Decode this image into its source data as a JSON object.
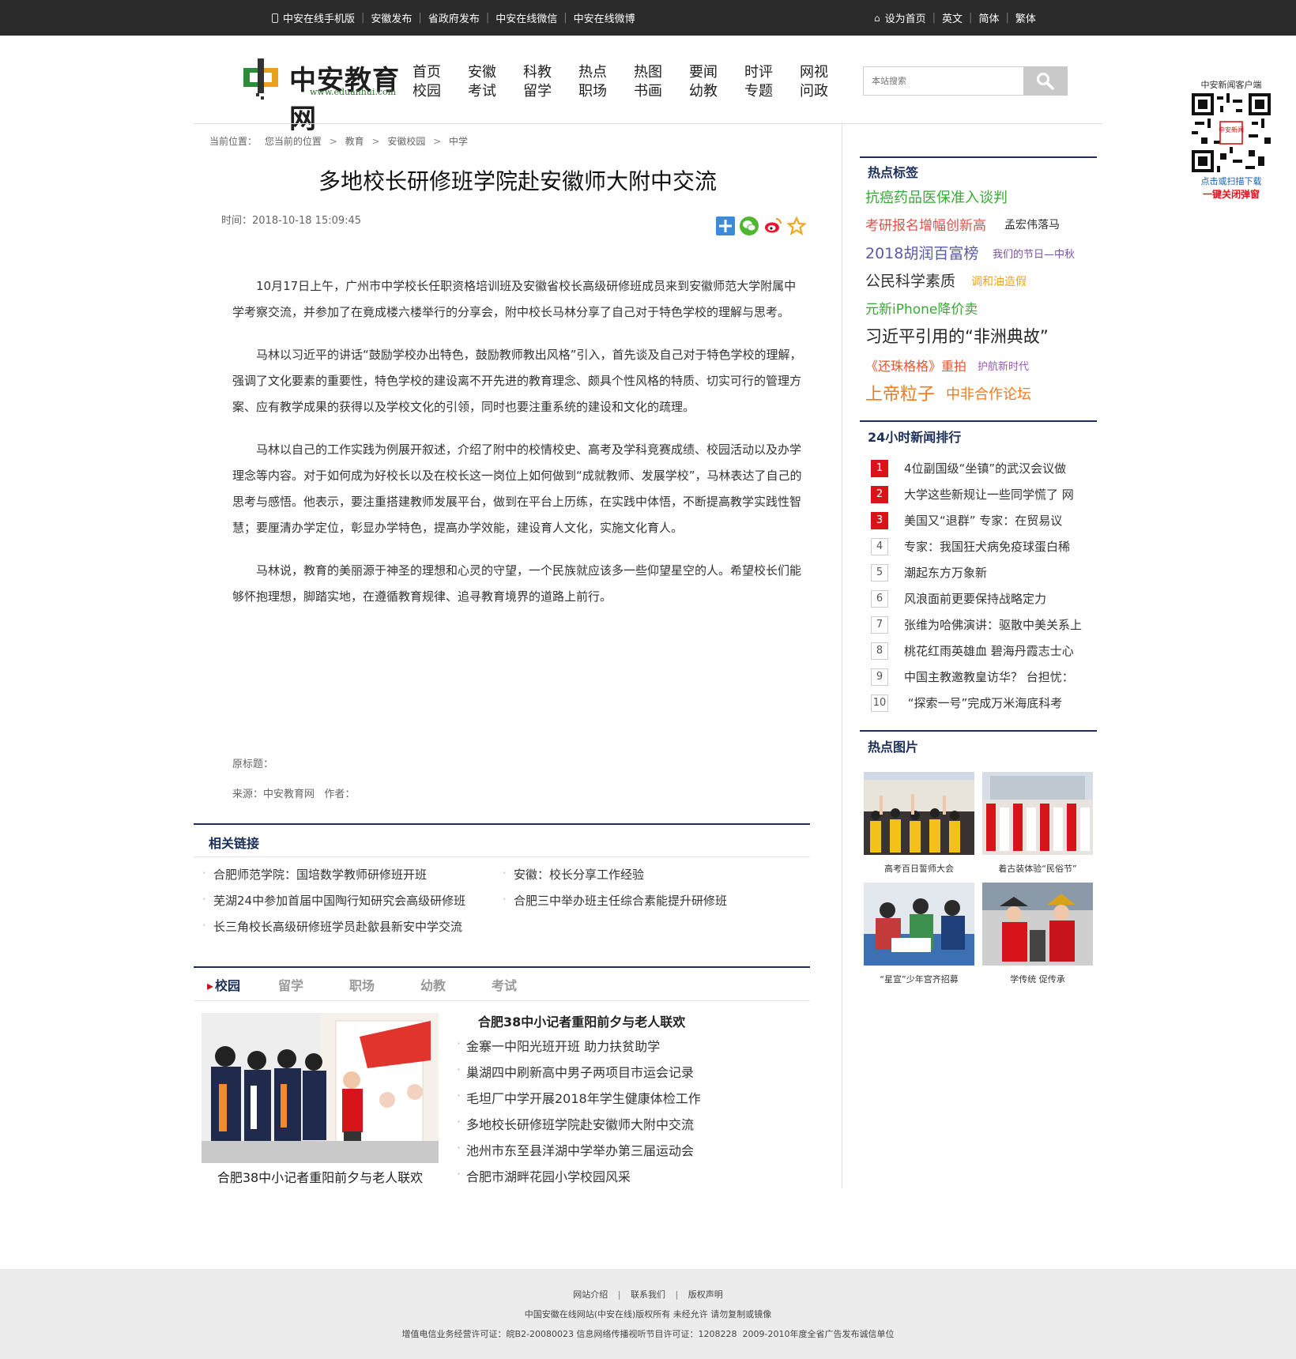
{
  "topbar": {
    "left_links": [
      "中安在线手机版",
      "安徽发布",
      "省政府发布",
      "中安在线微信",
      "中安在线微博"
    ],
    "right_links": [
      "设为首页",
      "英文",
      "简体",
      "繁体"
    ]
  },
  "logo": {
    "name": "中安教育网",
    "url": "www.eduanhui.com"
  },
  "nav": [
    [
      "首页",
      "校园"
    ],
    [
      "安徽",
      "考试"
    ],
    [
      "科教",
      "留学"
    ],
    [
      "热点",
      "职场"
    ],
    [
      "热图",
      "书画"
    ],
    [
      "要闻",
      "幼教"
    ],
    [
      "时评",
      "专题"
    ],
    [
      "网视",
      "问政"
    ]
  ],
  "search": {
    "placeholder": "本站搜索"
  },
  "qr": {
    "title": "中安新闻客户端",
    "download": "点击或扫描下载",
    "close": "一键关闭弹窗",
    "badge": "中安新闻"
  },
  "breadcrumb": {
    "label": "当前位置：",
    "items": [
      "您当前的位置",
      "教育",
      "安徽校园",
      "中学"
    ]
  },
  "article": {
    "title": "多地校长研修班学院赴安徽师大附中交流",
    "time": "时间：2018-10-18 15:09:45",
    "paragraphs": [
      "10月17日上午，广州市中学校长任职资格培训班及安徽省校长高级研修班成员来到安徽师范大学附属中学考察交流，并参加了在竟成楼六楼举行的分享会，附中校长马林分享了自己对于特色学校的理解与思考。",
      "马林以习近平的讲话“鼓励学校办出特色，鼓励教师教出风格”引入，首先谈及自己对于特色学校的理解，强调了文化要素的重要性，特色学校的建设离不开先进的教育理念、颇具个性风格的特质、切实可行的管理方案、应有教学成果的获得以及学校文化的引领，同时也要注重系统的建设和文化的疏理。",
      "马林以自己的工作实践为例展开叙述，介绍了附中的校情校史、高考及学科竞赛成绩、校园活动以及办学理念等内容。对于如何成为好校长以及在校长这一岗位上如何做到“成就教师、发展学校”，马林表达了自己的思考与感悟。他表示，要注重搭建教师发展平台，做到在平台上历练，在实践中体悟，不断提高教学实践性智慧；要厘清办学定位，彰显办学特色，提高办学效能，建设育人文化，实施文化育人。",
      "马林说，教育的美丽源于神圣的理想和心灵的守望，一个民族就应该多一些仰望星空的人。希望校长们能够怀抱理想，脚踏实地，在遵循教育规律、追寻教育境界的道路上前行。"
    ],
    "original_title": "原标题：",
    "source": "来源：中安教育网   作者："
  },
  "related": {
    "title": "相关链接",
    "items": [
      "合肥师范学院：国培数学教师研修班开班",
      "安徽：校长分享工作经验",
      "芜湖24中参加首届中国陶行知研究会高级研修班",
      "合肥三中举办班主任综合素能提升研修班",
      "长三角校长高级研修班学员赴歙县新安中学交流"
    ]
  },
  "tabs": {
    "labels": [
      "校园",
      "留学",
      "职场",
      "幼教",
      "考试"
    ],
    "feature_caption": "合肥38中小记者重阳前夕与老人联欢",
    "headline": "合肥38中小记者重阳前夕与老人联欢",
    "items": [
      "金寨一中阳光班开班 助力扶贫助学",
      "巢湖四中刷新高中男子两项目市运会记录",
      "毛坦厂中学开展2018年学生健康体检工作",
      "多地校长研修班学院赴安徽师大附中交流",
      "池州市东至县洋湖中学举办第三届运动会",
      "合肥市湖畔花园小学校园风采"
    ]
  },
  "sidebar": {
    "tags_title": "热点标签",
    "tags": [
      {
        "text": "抗癌药品医保准入谈判",
        "color": "#3aa835"
      },
      {
        "text": "考研报名增幅创新高",
        "color": "#d9534a"
      },
      {
        "text": "孟宏伟落马",
        "color": "#333333"
      },
      {
        "text": "2018胡润百富榜",
        "color": "#5a5aa8"
      },
      {
        "text": "我们的节日—中秋",
        "color": "#7b4fa8"
      },
      {
        "text": "公民科学素质",
        "color": "#333333"
      },
      {
        "text": "调和油造假",
        "color": "#e9a41d"
      },
      {
        "text": "元新iPhone降价卖",
        "color": "#3aa835"
      },
      {
        "text": "习近平引用的“非洲典故”",
        "color": "#222222"
      },
      {
        "text": "《还珠格格》重拍",
        "color": "#e0552e"
      },
      {
        "text": "护航新时代",
        "color": "#9b59b6"
      },
      {
        "text": "上帝粒子",
        "color": "#f07b1e"
      },
      {
        "text": "中非合作论坛",
        "color": "#f07b1e"
      }
    ],
    "rank_title": "24小时新闻排行",
    "ranks": [
      {
        "n": "1",
        "text": "4位副国级“坐镇”的武汉会议做",
        "hot": true
      },
      {
        "n": "2",
        "text": "大学这些新规让一些同学慌了 网",
        "hot": true
      },
      {
        "n": "3",
        "text": "美国又“退群” 专家：在贸易议",
        "hot": true
      },
      {
        "n": "4",
        "text": "专家：我国狂犬病免疫球蛋白稀",
        "hot": false
      },
      {
        "n": "5",
        "text": "潮起东方万象新",
        "hot": false
      },
      {
        "n": "6",
        "text": "风浪面前更要保持战略定力",
        "hot": false
      },
      {
        "n": "7",
        "text": "张维为哈佛演讲：驱散中美关系上",
        "hot": false
      },
      {
        "n": "8",
        "text": "桃花红雨英雄血 碧海丹霞志士心",
        "hot": false
      },
      {
        "n": "9",
        "text": "中国主教邀教皇访华？ 台担忧：",
        "hot": false
      },
      {
        "n": "10",
        "text": " “探索一号”完成万米海底科考",
        "hot": false
      }
    ],
    "pics_title": "热点图片",
    "pics": [
      "高考百日誓师大会",
      "着古装体验“民俗节”",
      "“星宣”少年宫齐招募",
      "学传统 促传承"
    ]
  },
  "footer": {
    "links": [
      "网站介绍",
      "联系我们",
      "版权声明"
    ],
    "line2": "中国安徽在线网站(中安在线)版权所有 未经允许 请勿复制或镜像",
    "line3": "增值电信业务经营许可证：皖B2-20080023 信息网络传播视听节目许可证：1208228  2009-2010年度全省广告发布诚信单位"
  }
}
